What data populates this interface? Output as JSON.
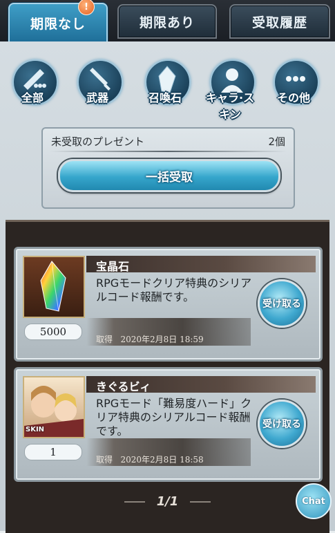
{
  "tabs": [
    {
      "label": "期限なし",
      "active": true
    },
    {
      "label": "期限あり",
      "active": false
    },
    {
      "label": "受取履歴",
      "active": false
    }
  ],
  "tab_badge": "!",
  "categories": [
    {
      "label": "全部",
      "icon": "all-items-icon"
    },
    {
      "label": "武器",
      "icon": "sword-icon"
    },
    {
      "label": "召喚石",
      "icon": "crystal-icon"
    },
    {
      "label": "キャラ·スキン",
      "icon": "character-icon"
    },
    {
      "label": "その他",
      "icon": "more-dots-icon"
    }
  ],
  "present_box": {
    "title": "未受取のプレゼント",
    "count": "2個",
    "bulk_button": "一括受取"
  },
  "items": [
    {
      "name": "宝晶石",
      "description": "RPGモードクリア特典のシリアルコード報酬です。",
      "quantity": "5000",
      "acquired_label": "取得",
      "acquired_date": "2020年2月8日 18:59",
      "receive_label": "受け取る",
      "thumb": "crystal-gem-icon"
    },
    {
      "name": "きぐるビィ",
      "description": "RPGモード「難易度ハード」クリア特典のシリアルコード報酬です。",
      "quantity": "1",
      "acquired_label": "取得",
      "acquired_date": "2020年2月8日 18:58",
      "receive_label": "受け取る",
      "thumb": "character-skin-icon",
      "thumb_caption": "SKIN"
    }
  ],
  "pager": "1/1",
  "chat_label": "Chat"
}
